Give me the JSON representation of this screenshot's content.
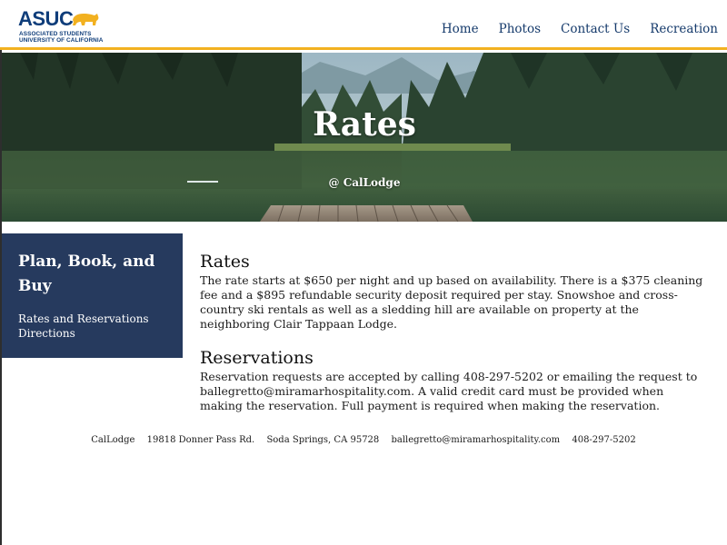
{
  "header": {
    "logo": {
      "main": "ASUC",
      "line1": "ASSOCIATED STUDENTS",
      "line2": "UNIVERSITY OF CALIFORNIA",
      "brand_color": "#0f3d7a",
      "accent_color": "#f2b120"
    },
    "nav": [
      "Home",
      "Photos",
      "Contact Us",
      "Recreation"
    ]
  },
  "hero": {
    "title": "Rates",
    "subtitle": "@ CalLodge"
  },
  "sidebar": {
    "title": "Plan, Book, and Buy",
    "links": [
      "Rates and Reservations",
      "Directions"
    ],
    "bg_color": "#263a5e"
  },
  "main": {
    "rates_heading": "Rates",
    "rates_text": "The rate starts at $650 per night and up based on availability. There is a $375 cleaning fee and a $895 refundable security deposit required per stay. Snowshoe and cross-country ski rentals as well as a sledding hill are available on property at the neighboring Clair Tappaan Lodge.",
    "res_heading": "Reservations",
    "res_text": "Reservation requests are accepted by calling 408-297-5202 or emailing the request to ballegretto@miramarhospitality.com. A valid credit card must be provided when making the reservation. Full payment is required when making the reservation."
  },
  "footer": {
    "name": "CalLodge",
    "address": "19818 Donner Pass Rd.",
    "city": "Soda Springs, CA 95728",
    "email": "ballegretto@miramarhospitality.com",
    "phone": "408-297-5202"
  }
}
